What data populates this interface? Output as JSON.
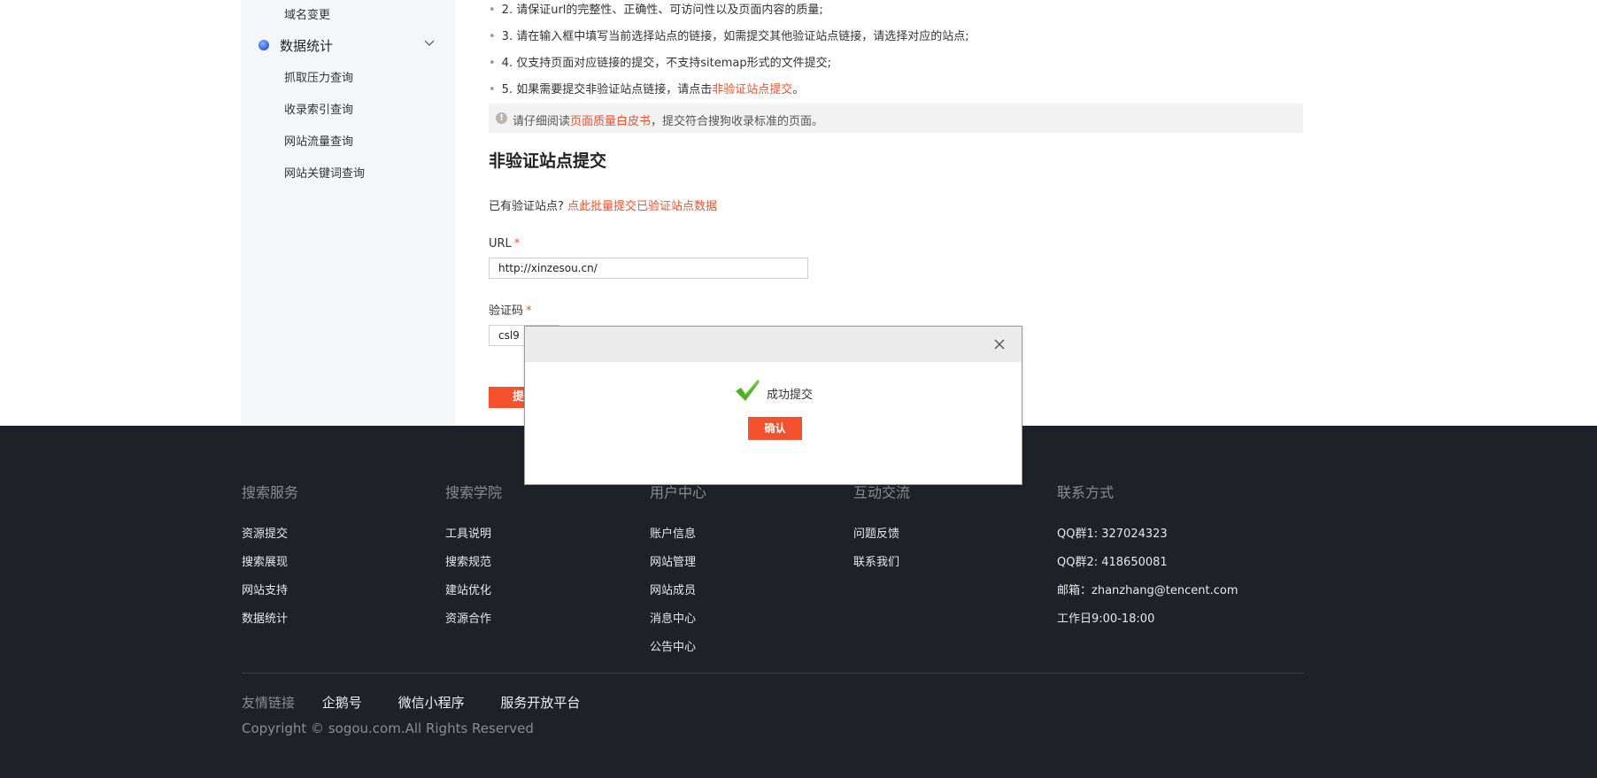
{
  "sidebar": {
    "partial_top_item": "域名变更",
    "group": {
      "label": "数据统计",
      "expanded": true
    },
    "sub_items": [
      "抓取压力查询",
      "收录索引查询",
      "网站流量查询",
      "网站关键词查询"
    ]
  },
  "rules": [
    {
      "num": "2.",
      "text": "请保证url的完整性、正确性、可访问性以及页面内容的质量;"
    },
    {
      "num": "3.",
      "text": "请在输入框中填写当前选择站点的链接，如需提交其他验证站点链接，请选择对应的站点;"
    },
    {
      "num": "4.",
      "text": "仅支持页面对应链接的提交，不支持sitemap形式的文件提交;"
    },
    {
      "num": "5.",
      "text": "如果需要提交非验证站点链接，请点击",
      "link": "非验证站点提交",
      "suffix": "。"
    }
  ],
  "notice": {
    "prefix": "请仔细阅读",
    "link": "页面质量白皮书",
    "suffix": "，提交符合搜狗收录标准的页面。"
  },
  "section": {
    "title": "非验证站点提交",
    "verified_prompt": "已有验证站点?",
    "verified_link": "点此批量提交已验证站点数据"
  },
  "form": {
    "url_label": "URL",
    "url_value": "http://xinzesou.cn/",
    "captcha_label": "验证码",
    "captcha_value": "csl9",
    "required_mark": "*",
    "submit_label": "提"
  },
  "modal": {
    "message": "成功提交",
    "confirm_label": "确认"
  },
  "footer": {
    "columns": [
      {
        "title": "搜索服务",
        "items": [
          "资源提交",
          "搜索展现",
          "网站支持",
          "数据统计"
        ]
      },
      {
        "title": "搜索学院",
        "items": [
          "工具说明",
          "搜索规范",
          "建站优化",
          "资源合作"
        ]
      },
      {
        "title": "用户中心",
        "items": [
          "账户信息",
          "网站管理",
          "网站成员",
          "消息中心",
          "公告中心"
        ]
      },
      {
        "title": "互动交流",
        "items": [
          "问题反馈",
          "联系我们"
        ]
      },
      {
        "title": "联系方式",
        "items": [
          "QQ群1: 327024323",
          "QQ群2: 418650081",
          "邮箱：zhanzhang@tencent.com",
          "工作日9:00-18:00"
        ]
      }
    ],
    "friend_links_label": "友情链接",
    "friend_links": [
      "企鹅号",
      "微信小程序",
      "服务开放平台"
    ],
    "copyright": "Copyright © sogou.com.All Rights Reserved"
  },
  "colors": {
    "accent": "#f4522f",
    "footer_bg": "#1f2129",
    "sidebar_bg": "#f5f6fa"
  }
}
